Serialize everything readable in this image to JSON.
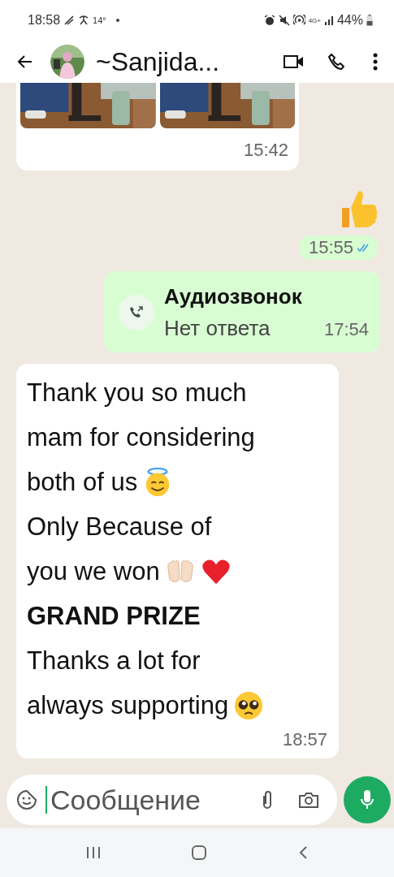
{
  "status_bar": {
    "time": "18:58",
    "temperature": "14°",
    "network": "4G+",
    "battery": "44%"
  },
  "header": {
    "contact_name": "~Sanjida..."
  },
  "messages": [
    {
      "kind": "photos",
      "outgoing": false,
      "time": "15:42"
    },
    {
      "kind": "emoji",
      "outgoing": true,
      "emoji": {
        "kind": "thumbs-up"
      },
      "time": "15:55",
      "read": true
    },
    {
      "kind": "call",
      "outgoing": true,
      "title": "Аудиозвонок",
      "subtitle": "Нет ответа",
      "time": "17:54"
    },
    {
      "kind": "text",
      "outgoing": false,
      "time": "18:57",
      "lines": [
        {
          "text": "Thank you so much",
          "bold": false
        },
        {
          "text": "mam for considering",
          "bold": false
        },
        {
          "text": "both of us",
          "bold": false,
          "emojis": [
            {
              "kind": "halo-smile"
            }
          ]
        },
        {
          "text": "Only Because of",
          "bold": false
        },
        {
          "text": "you we won",
          "bold": false,
          "emojis": [
            {
              "kind": "raised-hands"
            },
            {
              "kind": "red-heart"
            }
          ]
        },
        {
          "text": "GRAND PRIZE",
          "bold": true
        },
        {
          "text": "Thanks a lot for",
          "bold": false
        },
        {
          "text": "always supporting",
          "bold": false,
          "emojis": [
            {
              "kind": "pleading-face"
            }
          ]
        }
      ]
    }
  ],
  "composer": {
    "placeholder": "Сообщение"
  }
}
